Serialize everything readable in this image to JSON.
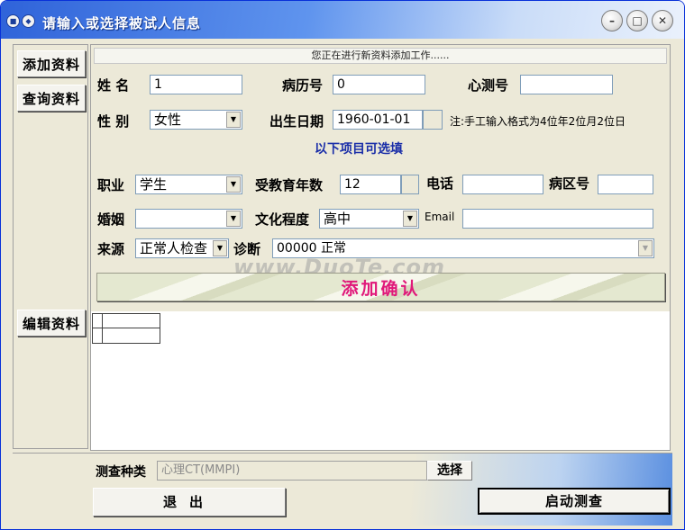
{
  "window": {
    "title": "请输入或选择被试人信息",
    "controls": [
      "minimize-icon",
      "maximize-icon",
      "close-icon"
    ]
  },
  "sidebar": {
    "add_label": "添加资料",
    "query_label": "查询资料",
    "edit_label": "编辑资料"
  },
  "status_text": "您正在进行新资料添加工作......",
  "form": {
    "name_label": "姓  名",
    "name_value": "1",
    "record_label": "病历号",
    "record_value": "0",
    "psych_label": "心测号",
    "psych_value": "",
    "gender_label": "性  别",
    "gender_value": "女性",
    "birth_label": "出生日期",
    "birth_value": "1960-01-01",
    "birth_note": "注:手工输入格式为4位年2位月2位日",
    "optional_heading": "以下项目可选填",
    "job_label": "职业",
    "job_value": "学生",
    "edu_years_label": "受教育年数",
    "edu_years_value": "12",
    "phone_label": "电话",
    "phone_value": "",
    "ward_label": "病区号",
    "ward_value": "",
    "marriage_label": "婚姻",
    "marriage_value": "",
    "edu_level_label": "文化程度",
    "edu_level_value": "高中",
    "email_label": "Email",
    "email_value": "",
    "source_label": "来源",
    "source_value": "正常人检查",
    "diagnosis_label": "诊断",
    "diagnosis_value": "00000 正常"
  },
  "watermark": "www.DuoTe.com",
  "confirm_label": "添加确认",
  "bottom": {
    "category_label": "测查种类",
    "category_value": "心理CT(MMPI)",
    "choose_label": "选择",
    "exit_label": "退出",
    "start_label": "启动测查"
  }
}
